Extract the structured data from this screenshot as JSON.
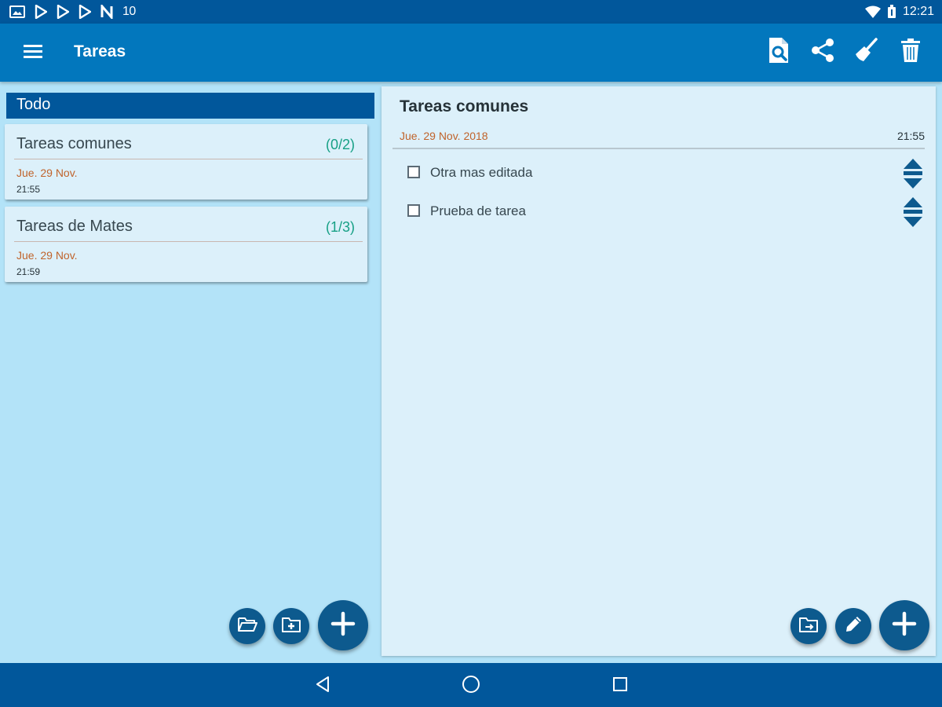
{
  "status_bar": {
    "notification_icons": [
      "gallery-icon",
      "play-store-icon",
      "play-store-icon",
      "play-store-icon",
      "n-icon"
    ],
    "extra_number": "10",
    "time": "12:21"
  },
  "app_bar": {
    "title": "Tareas",
    "actions": [
      "search-document-icon",
      "share-icon",
      "broom-icon",
      "trash-icon"
    ]
  },
  "left": {
    "group_header": "Todo",
    "lists": [
      {
        "name": "Tareas comunes",
        "count": "(0/2)",
        "date": "Jue. 29 Nov.",
        "time": "21:55"
      },
      {
        "name": "Tareas de Mates",
        "count": "(1/3)",
        "date": "Jue. 29 Nov.",
        "time": "21:59"
      }
    ]
  },
  "detail": {
    "title": "Tareas comunes",
    "date": "Jue. 29 Nov. 2018",
    "time": "21:55",
    "tasks": [
      {
        "label": "Otra mas editada",
        "checked": false
      },
      {
        "label": "Prueba de tarea",
        "checked": false
      }
    ]
  },
  "colors": {
    "status_bar": "#01579b",
    "app_bar": "#0277bd",
    "background": "#b3e3f8",
    "card": "#dcf0fa",
    "fab": "#0d5a8e",
    "date_text": "#c0632b",
    "count_text": "#16a085"
  }
}
